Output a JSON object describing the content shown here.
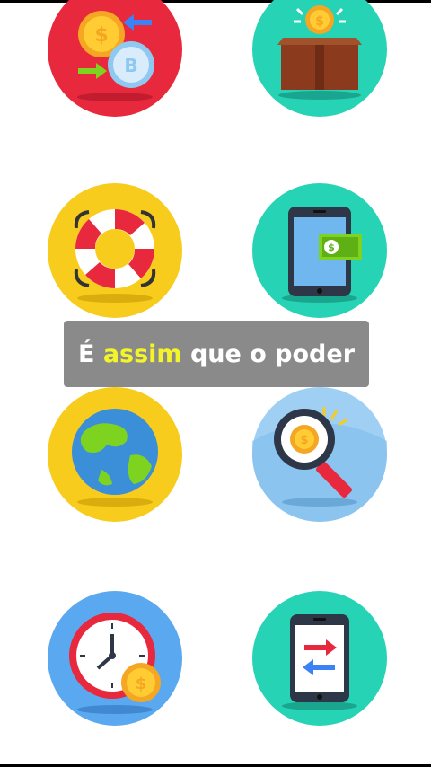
{
  "caption": {
    "part1": "É ",
    "highlight": "assim",
    "part2": " que o poder",
    "highlight_color": "#f4f42a"
  },
  "icons": [
    {
      "name": "crypto-exchange-icon",
      "circle_color": "#e8283c"
    },
    {
      "name": "money-box-icon",
      "circle_color": "#26d3b5"
    },
    {
      "name": "lifebuoy-icon",
      "circle_color": "#f8cc1c"
    },
    {
      "name": "mobile-payment-icon",
      "circle_color": "#26d3b5"
    },
    {
      "name": "globe-icon",
      "circle_color": "#f8cc1c"
    },
    {
      "name": "coin-search-icon",
      "circle_color": "#9fd0f3"
    },
    {
      "name": "clock-coin-icon",
      "circle_color": "#5aa8ef"
    },
    {
      "name": "mobile-transfer-icon",
      "circle_color": "#26d3b5"
    }
  ]
}
